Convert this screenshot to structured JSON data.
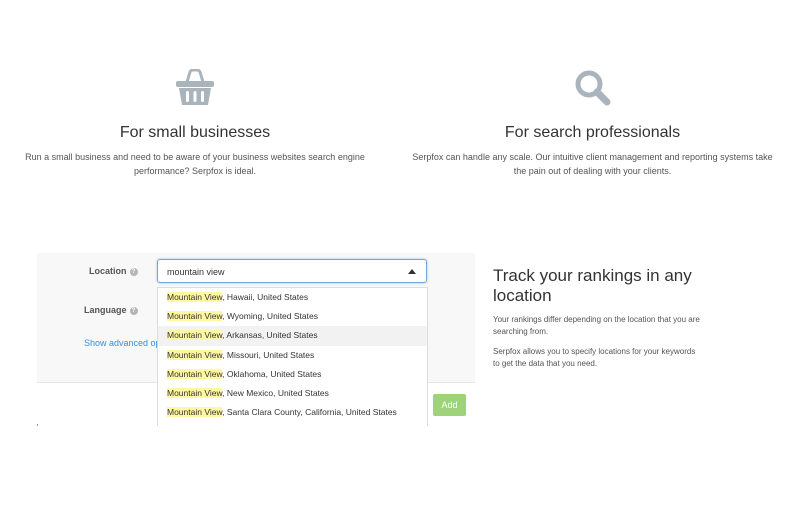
{
  "features": {
    "small": {
      "icon": "basket-icon",
      "title": "For small businesses",
      "text": "Run a small business and need to be aware of your business websites search engine performance? Serpfox is ideal."
    },
    "pro": {
      "icon": "search-icon",
      "title": "For search professionals",
      "text": "Serpfox can handle any scale. Our intuitive client management and reporting systems take the pain out of dealing with your clients."
    }
  },
  "form": {
    "location_label": "Location",
    "language_label": "Language",
    "help_glyph": "?",
    "location_value": "mountain view",
    "advanced_link": "Show advanced options",
    "add_label": "Add",
    "suggestions": [
      {
        "match": "Mountain View",
        "rest": ", Hawaii, United States"
      },
      {
        "match": "Mountain View",
        "rest": ", Wyoming, United States"
      },
      {
        "match": "Mountain View",
        "rest": ", Arkansas, United States"
      },
      {
        "match": "Mountain View",
        "rest": ", Missouri, United States"
      },
      {
        "match": "Mountain View",
        "rest": ", Oklahoma, United States"
      },
      {
        "match": "Mountain View",
        "rest": ", New Mexico, United States"
      },
      {
        "match": "Mountain View",
        "rest": ", Santa Clara County, California, United States"
      }
    ]
  },
  "track": {
    "title": "Track your rankings in any location",
    "para1": "Your rankings differ depending on the location that you are searching from.",
    "para2": "Serpfox allows you to specify locations for your keywords to get the data that you need."
  },
  "colors": {
    "accent_blue": "#3a8fd8",
    "add_green": "#9fd37a",
    "highlight": "#fff8a0",
    "icon_gray": "#a9b4bd"
  }
}
